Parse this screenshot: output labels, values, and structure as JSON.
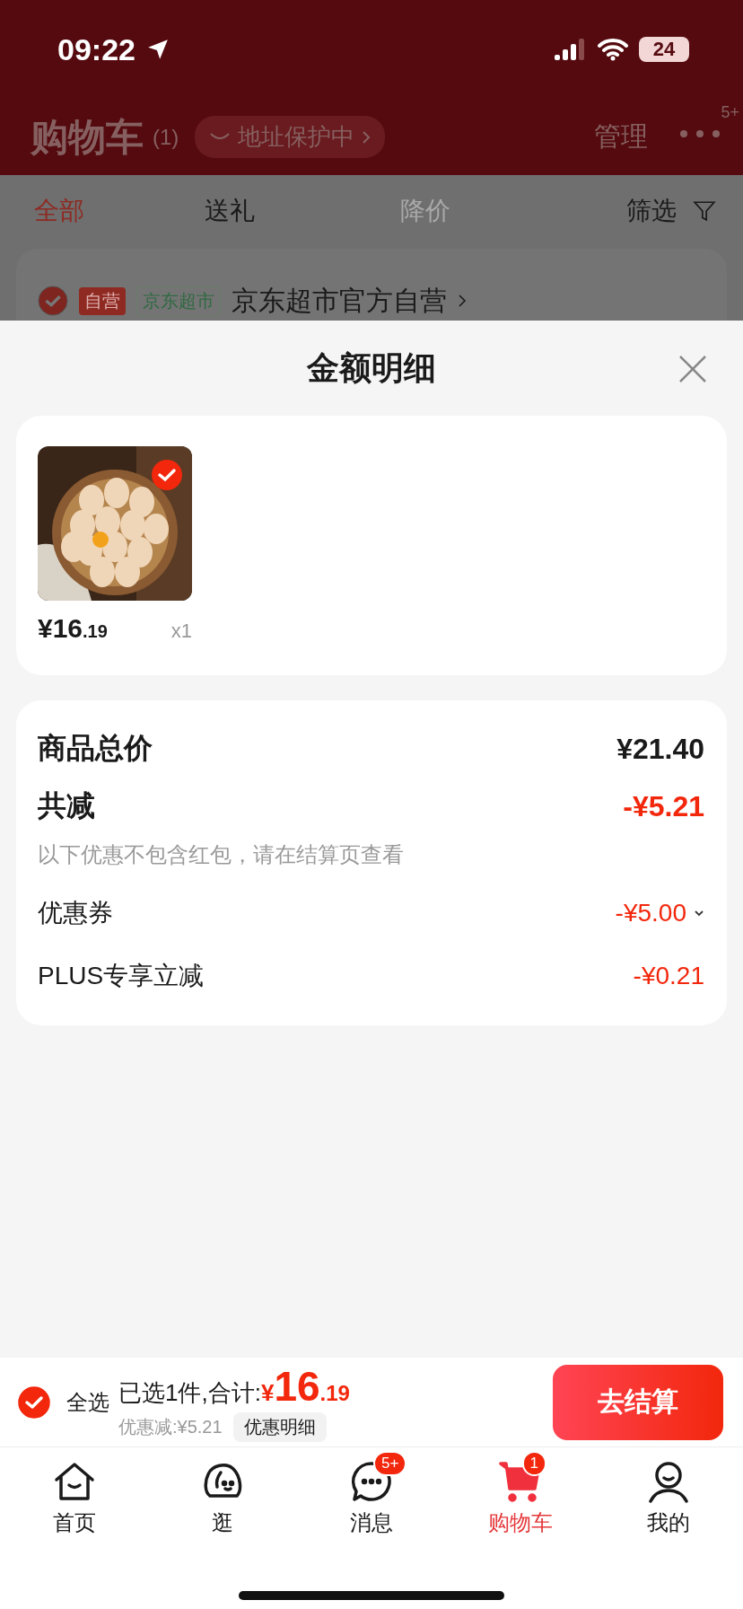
{
  "status_bar": {
    "time": "09:22",
    "battery": "24"
  },
  "header": {
    "title": "购物车",
    "count": "(1)",
    "address_badge": "地址保护中",
    "manage": "管理",
    "more_badge": "5+"
  },
  "filter_tabs": [
    {
      "label": "全部",
      "selected": true,
      "disabled": false
    },
    {
      "label": "送礼",
      "selected": false,
      "disabled": false
    },
    {
      "label": "降价",
      "selected": false,
      "disabled": true
    }
  ],
  "filter": "筛选",
  "store": {
    "checked": true,
    "self_run_tag": "自营",
    "channel_tag": "京东超市",
    "name": "京东超市官方自营"
  },
  "sheet": {
    "title": "金额明细",
    "items": [
      {
        "kind": "picture",
        "checked": true,
        "price_main": "¥16",
        "price_decimal": ".19",
        "quantity": "x1"
      }
    ],
    "summary": {
      "total_label": "商品总价",
      "total_value": "¥21.40",
      "reduction_label": "共减",
      "reduction_value": "-¥5.21",
      "note": "以下优惠不包含红包，请在结算页查看",
      "discounts": [
        {
          "label": "优惠券",
          "value": "-¥5.00",
          "expandable": true
        },
        {
          "label": "PLUS专享立减",
          "value": "-¥0.21",
          "expandable": false
        }
      ]
    }
  },
  "bottom_bar": {
    "checked": true,
    "select_all": "全选",
    "selected_text": "已选1件,合计:",
    "currency": "¥",
    "total_main": "16",
    "total_decimal": ".19",
    "saving": "优惠减:¥5.21",
    "detail_button": "优惠明细",
    "checkout": "去结算"
  },
  "nav": [
    {
      "label": "首页",
      "selected": false
    },
    {
      "label": "逛",
      "selected": false
    },
    {
      "label": "消息",
      "selected": false,
      "badge": "5+"
    },
    {
      "label": "购物车",
      "selected": true,
      "badge": "1"
    },
    {
      "label": "我的",
      "selected": false
    }
  ]
}
